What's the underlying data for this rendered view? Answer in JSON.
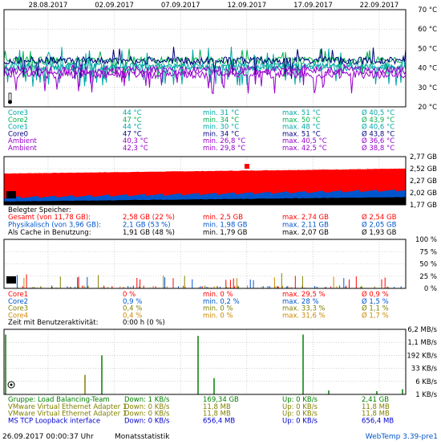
{
  "colors": {
    "background": "#ffffff",
    "plot_background": "#ffffff",
    "grid": "#b4b4b4",
    "frame": "#000000",
    "teal": "#00a8a8",
    "green": "#00b050",
    "purple": "#9900cc",
    "red": "#ff0000",
    "blue": "#0055cc",
    "dark_green": "#008000",
    "olive": "#808000",
    "orange": "#cc8800",
    "black": "#000000",
    "link_blue": "#0055cc"
  },
  "x_axis": {
    "dates": [
      "28.08.2017",
      "02.09.2017",
      "07.09.2017",
      "12.09.2017",
      "17.09.2017",
      "22.09.2017"
    ]
  },
  "temperature": {
    "chart_data": {
      "type": "line",
      "x_range": [
        "27.08.2017",
        "26.09.2017"
      ],
      "ylim": [
        20,
        70
      ],
      "yticks": [
        "70 °C",
        "60 °C",
        "50 °C",
        "40 °C",
        "30 °C",
        "20 °C"
      ],
      "series": [
        {
          "name": "Core3",
          "color": "#00a8a8",
          "min": 31,
          "max": 51,
          "avg": 40.5
        },
        {
          "name": "Core2",
          "color": "#00b050",
          "min": 34,
          "max": 50,
          "avg": 43.9
        },
        {
          "name": "Core1",
          "color": "#00a8a8",
          "min": 30,
          "max": 48,
          "avg": 40.6
        },
        {
          "name": "Core0",
          "color": "#000080",
          "min": 34,
          "max": 51,
          "avg": 43.8
        },
        {
          "name": "Ambient",
          "color": "#9900cc",
          "min": 26.8,
          "max": 40.5,
          "avg": 36.6
        },
        {
          "name": "Ambient",
          "color": "#9900cc",
          "min": 29.8,
          "max": 42.5,
          "avg": 38.8
        }
      ]
    },
    "icon": "thermometer-icon",
    "rows": [
      {
        "name": "Core3",
        "cur": "44 °C",
        "min": "min. 31 °C",
        "max": "max. 51 °C",
        "avg": "Ø 40,5 °C",
        "color": "#00a8a8"
      },
      {
        "name": "Core2",
        "cur": "47 °C",
        "min": "min. 34 °C",
        "max": "max. 50 °C",
        "avg": "Ø 43,9 °C",
        "color": "#00b050"
      },
      {
        "name": "Core1",
        "cur": "44 °C",
        "min": "min. 30 °C",
        "max": "max. 48 °C",
        "avg": "Ø 40,6 °C",
        "color": "#00a8a8"
      },
      {
        "name": "Core0",
        "cur": "47 °C",
        "min": "min. 34 °C",
        "max": "max. 51 °C",
        "avg": "Ø 43,8 °C",
        "color": "#000080"
      },
      {
        "name": "Ambient",
        "cur": "40,3 °C",
        "min": "min. 26,8 °C",
        "max": "max. 40,5 °C",
        "avg": "Ø 36,6 °C",
        "color": "#9900cc"
      },
      {
        "name": "Ambient",
        "cur": "42,3 °C",
        "min": "min. 29,8 °C",
        "max": "max. 42,5 °C",
        "avg": "Ø 38,8 °C",
        "color": "#9900cc"
      }
    ]
  },
  "memory": {
    "chart_data": {
      "type": "area",
      "x_range": [
        "27.08.2017",
        "26.09.2017"
      ],
      "ylim": [
        1.77,
        2.77
      ],
      "yticks": [
        "2,77 GB",
        "2,52 GB",
        "2,27 GB",
        "2,02 GB",
        "1,77 GB"
      ],
      "series": [
        {
          "name": "Gesamt",
          "color": "#ff0000",
          "start": 2.42,
          "end": 2.52
        },
        {
          "name": "Physikalisch",
          "color": "#0055cc",
          "start": 1.9,
          "end": 2.05
        },
        {
          "name": "Als Cache in Benutzung",
          "color": "#000000",
          "start": 1.84,
          "end": 1.93
        }
      ]
    },
    "icon": "memory-chip-icon",
    "heading": "Belegter Speicher:",
    "rows": [
      {
        "name": "Gesamt (von 11,78 GB):",
        "cur": "2,58 GB (22 %)",
        "min": "min. 2,5 GB",
        "max": "max. 2,74 GB",
        "avg": "Ø 2,54 GB",
        "color": "#ff0000"
      },
      {
        "name": "Physikalisch (von 3,96 GB):",
        "cur": "2,1 GB (53 %)",
        "min": "min. 1,98 GB",
        "max": "max. 2,11 GB",
        "avg": "Ø 2,05 GB",
        "color": "#0055cc"
      },
      {
        "name": "Als Cache in Benutzung:",
        "cur": "1,91 GB (48 %)",
        "min": "min. 1,79 GB",
        "max": "max. 2,07 GB",
        "avg": "Ø 1,93 GB",
        "color": "#000000"
      }
    ]
  },
  "cpu": {
    "chart_data": {
      "type": "line",
      "x_range": [
        "27.08.2017",
        "26.09.2017"
      ],
      "ylim": [
        0,
        100
      ],
      "yticks": [
        "100 %",
        "75 %",
        "50 %",
        "25 %",
        "0 %"
      ],
      "series": [
        {
          "name": "Core1",
          "color": "#ff0000",
          "max": 29.5,
          "avg": 0.9
        },
        {
          "name": "Core2",
          "color": "#0055cc",
          "max": 28,
          "avg": 1.5
        },
        {
          "name": "Core3",
          "color": "#808000",
          "max": 33.3,
          "avg": 1.1
        },
        {
          "name": "Core4",
          "color": "#cc8800",
          "max": 31.6,
          "avg": 1.7
        }
      ]
    },
    "icon": "cpu-icon",
    "rows": [
      {
        "name": "Core1",
        "cur": "0 %",
        "min": "min. 0 %",
        "max": "max. 29,5 %",
        "avg": "Ø 0,9 %",
        "color": "#ff0000"
      },
      {
        "name": "Core2",
        "cur": "0,9 %",
        "min": "min. 0,2 %",
        "max": "max. 28 %",
        "avg": "Ø 1,5 %",
        "color": "#0055cc"
      },
      {
        "name": "Core3",
        "cur": "0,4 %",
        "min": "min. 0 %",
        "max": "max. 33,3 %",
        "avg": "Ø 1,1 %",
        "color": "#808000"
      },
      {
        "name": "Core4",
        "cur": "0,4 %",
        "min": "min. 0 %",
        "max": "max. 31,6 %",
        "avg": "Ø 1,7 %",
        "color": "#cc8800"
      }
    ],
    "activity_label": "Zeit mit Benutzeraktivität:",
    "activity_value": "0:00 h (0 %)"
  },
  "network": {
    "chart_data": {
      "type": "bar",
      "x_range": [
        "27.08.2017",
        "26.09.2017"
      ],
      "scale": "log",
      "yticks": [
        "6,2 MB/s",
        "1,1 MB/s",
        "192 KB/s",
        "33 KB/s",
        "6 KB/s",
        "1 KB/s"
      ],
      "series": [
        {
          "name": "Gruppe: Load Balancing-Team",
          "color": "#008000"
        },
        {
          "name": "VMware Virtual Ethernet Adapter 1",
          "color": "#808000"
        },
        {
          "name": "VMware Virtual Ethernet Adapter 1",
          "color": "#808000"
        },
        {
          "name": "MS TCP Loopback interface",
          "color": "#0000cc"
        }
      ]
    },
    "icon": "network-icon",
    "rows": [
      {
        "name": "Gruppe: Load Balancing-Team",
        "down": "Down: 1 KB/s",
        "down_total": "169,34 GB",
        "up": "Up: 0 KB/s",
        "up_total": "2,41 GB",
        "color": "#008000"
      },
      {
        "name": "VMware Virtual Ethernet Adapter 1",
        "down": "Down: 0 KB/s",
        "down_total": "11,8 MB",
        "up": "Up: 0 KB/s",
        "up_total": "11,8 MB",
        "color": "#808000"
      },
      {
        "name": "VMware Virtual Ethernet Adapter 1",
        "down": "Down: 0 KB/s",
        "down_total": "11,8 MB",
        "up": "Up: 0 KB/s",
        "up_total": "11,8 MB",
        "color": "#808000"
      },
      {
        "name": "MS TCP Loopback interface",
        "down": "Down: 0 KB/s",
        "down_total": "656,4 MB",
        "up": "Up: 0 KB/s",
        "up_total": "656,4 MB",
        "color": "#0000cc"
      }
    ]
  },
  "footer": {
    "timestamp": "26.09.2017 00:00:37 Uhr",
    "view": "Monatsstatistik",
    "app": "WebTemp 3.39-pre1"
  }
}
